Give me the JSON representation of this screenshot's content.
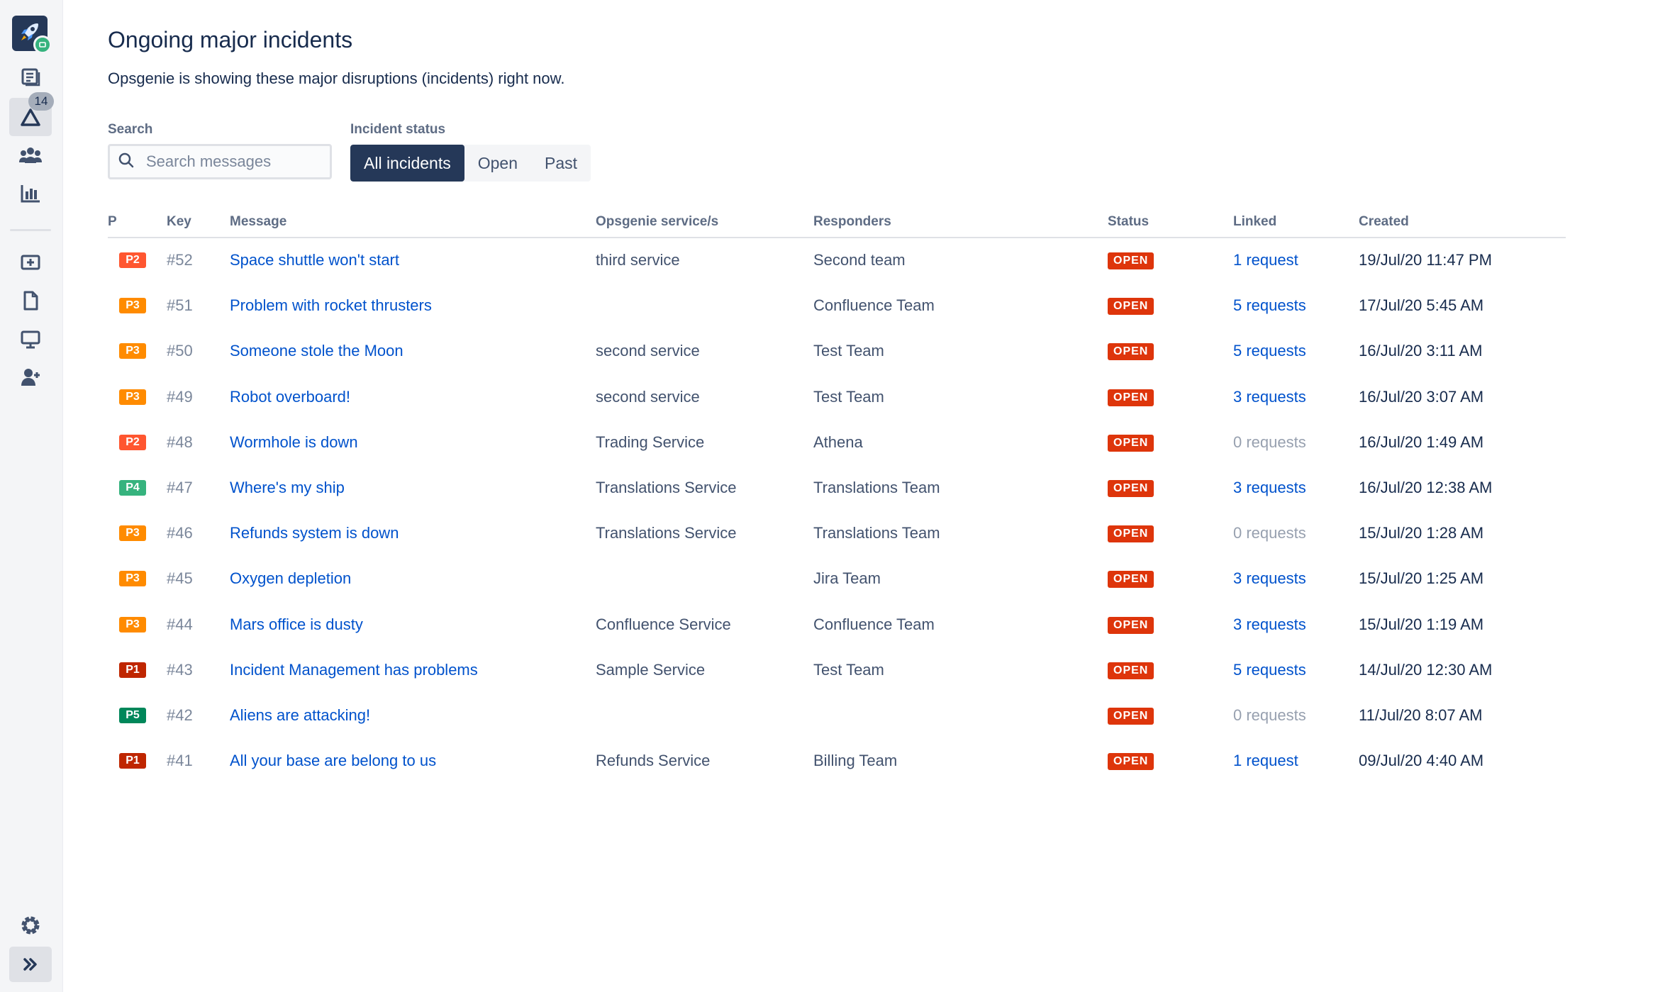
{
  "sidebar": {
    "alerts_count": "14",
    "items": [
      {
        "name": "knowledge-base",
        "icon": "document-icon"
      },
      {
        "name": "incidents",
        "icon": "alert-triangle-icon"
      },
      {
        "name": "teams",
        "icon": "people-icon"
      },
      {
        "name": "reports",
        "icon": "bar-chart-icon"
      },
      {
        "name": "add-request",
        "icon": "add-queue-icon"
      },
      {
        "name": "pages",
        "icon": "page-icon"
      },
      {
        "name": "channels",
        "icon": "monitor-icon"
      },
      {
        "name": "invite",
        "icon": "add-person-icon"
      },
      {
        "name": "settings",
        "icon": "gear-icon"
      },
      {
        "name": "expand",
        "icon": "chevron-double-right-icon"
      }
    ]
  },
  "page": {
    "title": "Ongoing major incidents",
    "description": "Opsgenie is showing these major disruptions (incidents) right now."
  },
  "filters": {
    "search_label": "Search",
    "search_placeholder": "Search messages",
    "status_label": "Incident status",
    "status_options": [
      "All incidents",
      "Open",
      "Past"
    ],
    "selected_status": "All incidents"
  },
  "table": {
    "headers": {
      "priority": "P",
      "key": "Key",
      "message": "Message",
      "service": "Opsgenie service/s",
      "responders": "Responders",
      "status": "Status",
      "linked": "Linked",
      "created": "Created"
    },
    "rows": [
      {
        "priority": "P2",
        "key": "#52",
        "message": "Space shuttle won't start",
        "service": "third service",
        "responders": "Second team",
        "status": "OPEN",
        "linked": "1 request",
        "created": "19/Jul/20 11:47 PM"
      },
      {
        "priority": "P3",
        "key": "#51",
        "message": "Problem with rocket thrusters",
        "service": "",
        "responders": "Confluence Team",
        "status": "OPEN",
        "linked": "5 requests",
        "created": "17/Jul/20 5:45 AM"
      },
      {
        "priority": "P3",
        "key": "#50",
        "message": "Someone stole the Moon",
        "service": "second service",
        "responders": "Test Team",
        "status": "OPEN",
        "linked": "5 requests",
        "created": "16/Jul/20 3:11 AM"
      },
      {
        "priority": "P3",
        "key": "#49",
        "message": "Robot overboard!",
        "service": "second service",
        "responders": "Test Team",
        "status": "OPEN",
        "linked": "3 requests",
        "created": "16/Jul/20 3:07 AM"
      },
      {
        "priority": "P2",
        "key": "#48",
        "message": "Wormhole is down",
        "service": "Trading Service",
        "responders": "Athena",
        "status": "OPEN",
        "linked": "0 requests",
        "created": "16/Jul/20 1:49 AM"
      },
      {
        "priority": "P4",
        "key": "#47",
        "message": "Where's my ship",
        "service": "Translations Service",
        "responders": "Translations Team",
        "status": "OPEN",
        "linked": "3 requests",
        "created": "16/Jul/20 12:38 AM"
      },
      {
        "priority": "P3",
        "key": "#46",
        "message": "Refunds system is down",
        "service": "Translations Service",
        "responders": "Translations Team",
        "status": "OPEN",
        "linked": "0 requests",
        "created": "15/Jul/20 1:28 AM"
      },
      {
        "priority": "P3",
        "key": "#45",
        "message": "Oxygen depletion",
        "service": "",
        "responders": "Jira Team",
        "status": "OPEN",
        "linked": "3 requests",
        "created": "15/Jul/20 1:25 AM"
      },
      {
        "priority": "P3",
        "key": "#44",
        "message": "Mars office is dusty",
        "service": "Confluence Service",
        "responders": "Confluence Team",
        "status": "OPEN",
        "linked": "3 requests",
        "created": "15/Jul/20 1:19 AM"
      },
      {
        "priority": "P1",
        "key": "#43",
        "message": "Incident Management has problems",
        "service": "Sample Service",
        "responders": "Test Team",
        "status": "OPEN",
        "linked": "5 requests",
        "created": "14/Jul/20 12:30 AM"
      },
      {
        "priority": "P5",
        "key": "#42",
        "message": "Aliens are attacking!",
        "service": "",
        "responders": "",
        "status": "OPEN",
        "linked": "0 requests",
        "created": "11/Jul/20 8:07 AM"
      },
      {
        "priority": "P1",
        "key": "#41",
        "message": "All your base are belong to us",
        "service": "Refunds Service",
        "responders": "Billing Team",
        "status": "OPEN",
        "linked": "1 request",
        "created": "09/Jul/20 4:40 AM"
      }
    ]
  },
  "colors": {
    "P1": "#BF2600",
    "P2": "#FF5630",
    "P3": "#FF8B00",
    "P4": "#36B37E",
    "P5": "#00875A",
    "status_open": "#DE350B",
    "link": "#0052CC",
    "selected_segment": "#253858"
  }
}
